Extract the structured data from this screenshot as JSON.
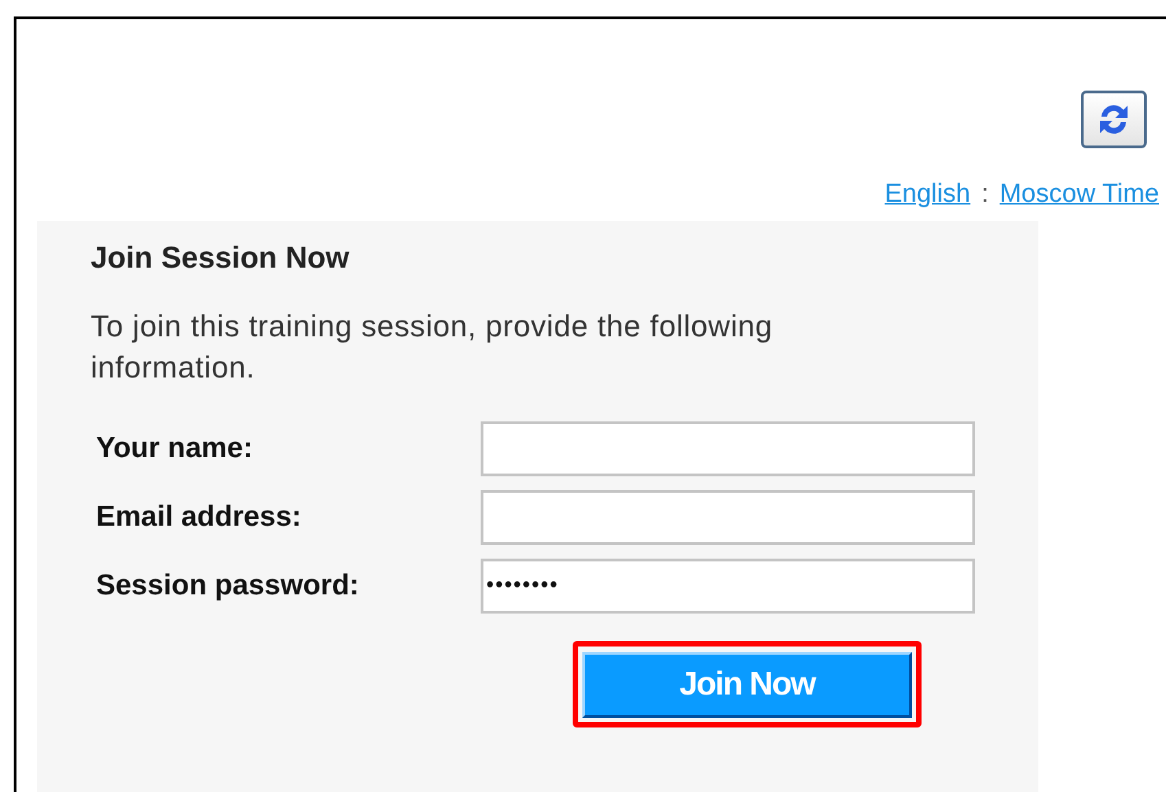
{
  "header": {
    "language_link": "English",
    "separator": ":",
    "timezone_link": "Moscow Time"
  },
  "panel": {
    "title": "Join Session Now",
    "instructions": "To join this training session, provide the following information.",
    "fields": [
      {
        "label": "Your name:"
      },
      {
        "label": "Email address:"
      },
      {
        "label": "Session password:",
        "value": "••••••••"
      }
    ],
    "button": {
      "label": "Join Now",
      "highlighted": true
    }
  }
}
